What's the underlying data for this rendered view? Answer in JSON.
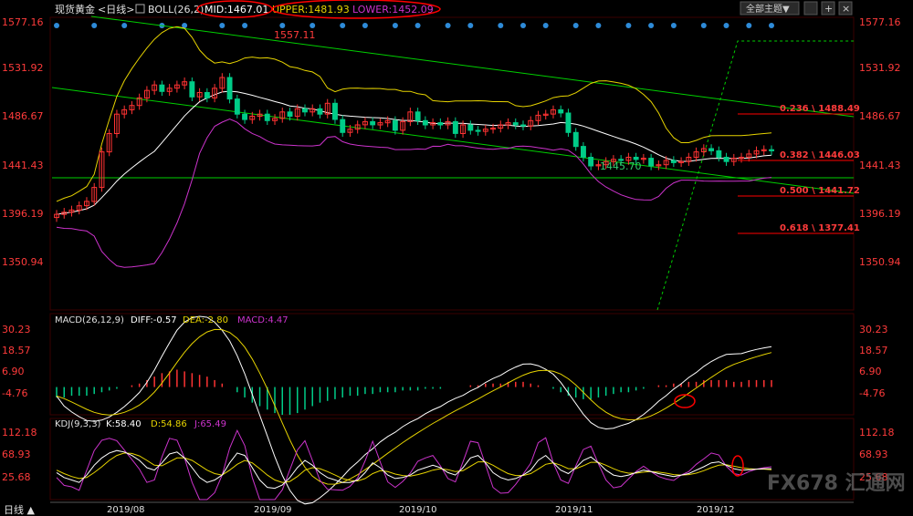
{
  "header": {
    "instrument": "现货黄金",
    "period_label": "<日线>",
    "boll_label": "BOLL(26,2)",
    "mid_label": "MID:1467.01",
    "upper_label": "UPPER:1481.93",
    "lower_label": "LOWER:1452.09",
    "theme_button": "全部主题▼",
    "colors": {
      "mid": "#ffffff",
      "upper": "#e6d300",
      "lower": "#cc33cc",
      "annotation_circle": "#ff0000"
    }
  },
  "price_axis": {
    "ticks": [
      "1577.16",
      "1531.92",
      "1486.67",
      "1441.43",
      "1396.19",
      "1350.94"
    ]
  },
  "macd_axis": {
    "ticks": [
      "30.23",
      "18.57",
      "6.90",
      "-4.76"
    ]
  },
  "kdj_axis": {
    "ticks": [
      "112.18",
      "68.93",
      "25.68"
    ]
  },
  "x_axis": {
    "labels": [
      "2019/08",
      "2019/09",
      "2019/10",
      "2019/11",
      "2019/12"
    ]
  },
  "annotations": {
    "high_label": "1557.11",
    "low_label": "1445.70"
  },
  "fib_levels": [
    {
      "label": "0.236 \\ 1488.49",
      "value": 1488.49
    },
    {
      "label": "0.382 \\ 1446.03",
      "value": 1446.03
    },
    {
      "label": "0.500 \\ 1441.72",
      "value": 1441.72
    },
    {
      "label": "0.618 \\ 1377.41",
      "value": 1377.41
    }
  ],
  "macd_header": {
    "title": "MACD(26,12,9)",
    "diff": "DIFF:-0.57",
    "dea": "DEA:-2.80",
    "macd": "MACD:4.47"
  },
  "kdj_header": {
    "title": "KDJ(9,3,3)",
    "k": "K:58.40",
    "d": "D:54.86",
    "j": "J:65.49"
  },
  "bottom_bar": {
    "label": "日线 ▲"
  },
  "watermark": {
    "text": "FX678 汇通网"
  },
  "chart_data": {
    "type": "candlestick",
    "price_range": [
      1328.3,
      1599.8
    ],
    "series_price": [
      1417,
      1419,
      1421,
      1425,
      1429,
      1442,
      1475,
      1492,
      1510,
      1514,
      1518,
      1525,
      1532,
      1537,
      1531,
      1534,
      1537,
      1540,
      1526,
      1530,
      1525,
      1534,
      1544,
      1524,
      1510,
      1505,
      1508,
      1510,
      1504,
      1506,
      1512,
      1508,
      1515,
      1512,
      1515,
      1510,
      1520,
      1505,
      1493,
      1496,
      1500,
      1503,
      1500,
      1502,
      1504,
      1495,
      1503,
      1512,
      1504,
      1500,
      1502,
      1500,
      1503,
      1492,
      1500,
      1495,
      1494,
      1496,
      1497,
      1500,
      1502,
      1500,
      1499,
      1504,
      1509,
      1510,
      1514,
      1511,
      1493,
      1480,
      1470,
      1462,
      1463,
      1466,
      1468,
      1467,
      1470,
      1468,
      1469,
      1462,
      1463,
      1467,
      1465,
      1466,
      1470,
      1475,
      1478,
      1476,
      1470,
      1466,
      1469,
      1470,
      1473,
      1476,
      1477,
      1476
    ],
    "macd_range": [
      -16,
      36
    ],
    "macd_hist": [
      -6,
      -6,
      -5,
      -5,
      -5,
      -4,
      -3,
      -2,
      -1,
      0,
      1,
      2,
      4,
      6,
      8,
      9,
      10,
      9,
      8,
      7,
      6,
      4,
      2,
      0,
      -3,
      -6,
      -9,
      -11,
      -13,
      -15,
      -16,
      -16,
      -15,
      -13,
      -11,
      -9,
      -8,
      -7,
      -6,
      -5,
      -5,
      -4,
      -4,
      -3,
      -3,
      -3,
      -2,
      -2,
      -2,
      -1,
      -1,
      -1,
      0,
      0,
      0,
      1,
      1,
      2,
      2,
      2,
      3,
      3,
      3,
      2,
      1,
      0,
      -1,
      -3,
      -5,
      -6,
      -7,
      -7,
      -6,
      -5,
      -4,
      -3,
      -3,
      -2,
      -1,
      0,
      1,
      1,
      2,
      2,
      3,
      3,
      4,
      4,
      4,
      4,
      3,
      3,
      4,
      4,
      4,
      4
    ],
    "kdj_range": [
      -5,
      140
    ],
    "kdj_k": [
      50,
      40,
      35,
      30,
      45,
      65,
      80,
      90,
      95,
      92,
      85,
      75,
      60,
      55,
      70,
      88,
      92,
      80,
      60,
      40,
      30,
      35,
      45,
      70,
      90,
      85,
      60,
      35,
      20,
      18,
      25,
      40,
      60,
      75,
      65,
      50,
      40,
      35,
      30,
      30,
      35,
      50,
      70,
      60,
      45,
      38,
      40,
      45,
      55,
      60,
      65,
      60,
      50,
      45,
      60,
      80,
      85,
      70,
      50,
      40,
      35,
      38,
      45,
      55,
      75,
      85,
      70,
      55,
      48,
      60,
      75,
      82,
      70,
      55,
      45,
      42,
      45,
      50,
      55,
      52,
      48,
      45,
      42,
      45,
      48,
      55,
      62,
      70,
      72,
      65,
      58,
      55,
      56,
      57,
      58,
      58
    ],
    "kdj_d": [
      55,
      48,
      42,
      38,
      40,
      50,
      62,
      75,
      85,
      90,
      89,
      84,
      75,
      65,
      64,
      72,
      80,
      80,
      75,
      65,
      55,
      48,
      45,
      55,
      67,
      75,
      70,
      58,
      45,
      35,
      30,
      32,
      42,
      55,
      60,
      58,
      52,
      45,
      38,
      34,
      33,
      38,
      48,
      54,
      52,
      47,
      44,
      43,
      46,
      50,
      55,
      58,
      56,
      52,
      54,
      63,
      72,
      72,
      65,
      56,
      48,
      44,
      44,
      48,
      57,
      67,
      70,
      65,
      58,
      58,
      64,
      71,
      71,
      65,
      58,
      52,
      49,
      49,
      51,
      52,
      51,
      49,
      46,
      45,
      46,
      49,
      54,
      60,
      65,
      66,
      63,
      60,
      58,
      57,
      57,
      56
    ],
    "colors": {
      "up_candle": "#ff3333",
      "down_candle": "#00cc88",
      "macd_up": "#ff3333",
      "macd_down": "#00cc88",
      "k": "#ffffff",
      "d": "#e6d300",
      "j": "#cc33cc",
      "channel": "#00d000",
      "fib": "#ff0000"
    }
  }
}
